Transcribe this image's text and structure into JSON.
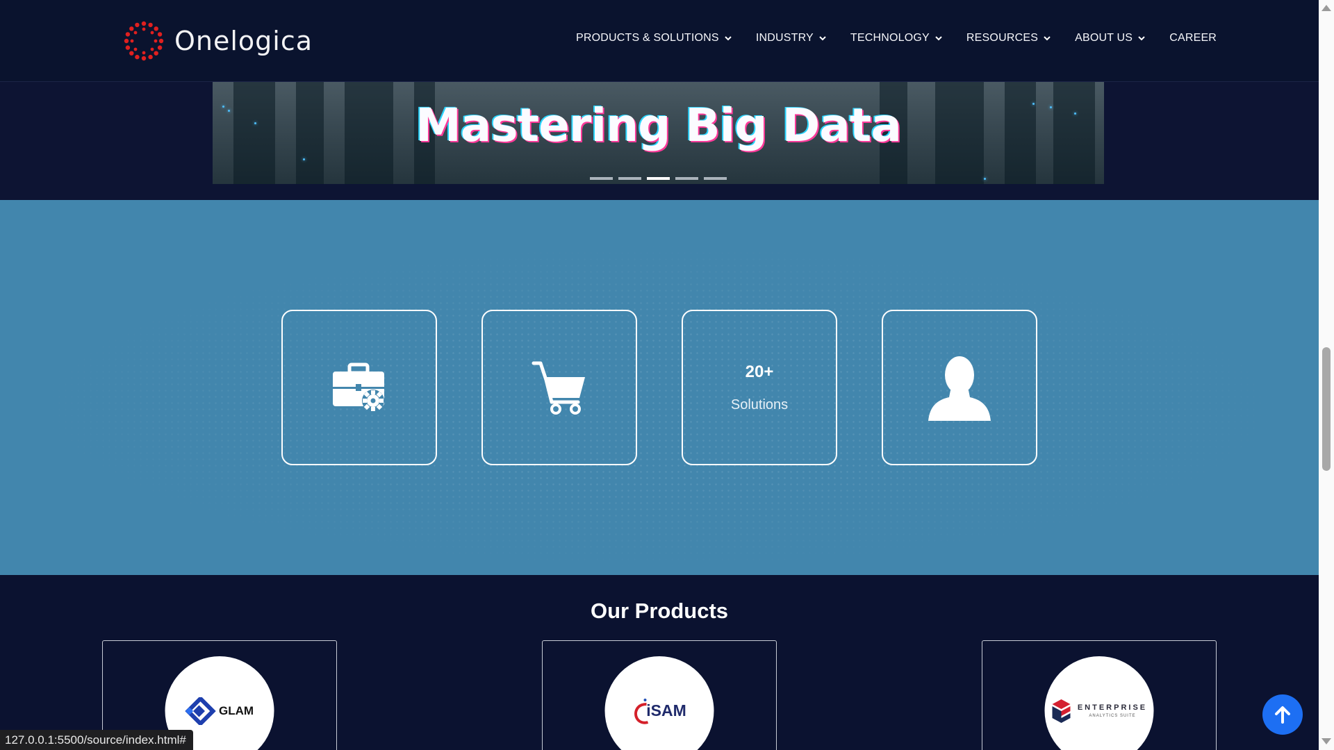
{
  "brand": {
    "name": "Onelogica",
    "mark_color": "#e02020"
  },
  "nav": {
    "items": [
      {
        "label": "PRODUCTS & SOLUTIONS",
        "has_dropdown": true
      },
      {
        "label": "INDUSTRY",
        "has_dropdown": true
      },
      {
        "label": "TECHNOLOGY",
        "has_dropdown": true
      },
      {
        "label": "RESOURCES",
        "has_dropdown": true
      },
      {
        "label": "ABOUT US",
        "has_dropdown": true
      },
      {
        "label": "CAREER",
        "has_dropdown": false
      }
    ]
  },
  "hero": {
    "title": "Mastering Big Data",
    "slide_count": 5,
    "active_slide": 3
  },
  "stats": {
    "background": "#4286ad",
    "cards": [
      {
        "icon": "briefcase-gear-icon",
        "number": "",
        "label": ""
      },
      {
        "icon": "shopping-cart-icon",
        "number": "",
        "label": ""
      },
      {
        "icon": "",
        "number": "20+",
        "label": "Solutions"
      },
      {
        "icon": "user-silhouette-icon",
        "number": "",
        "label": ""
      }
    ]
  },
  "products": {
    "title": "Our Products",
    "items": [
      {
        "logo_text": "GLAM",
        "logo_icon": "glam-logo-icon"
      },
      {
        "logo_text": "iSAM",
        "logo_icon": "isam-logo-icon"
      },
      {
        "logo_text": "ENTERPRISE",
        "logo_subtext": "ANALYTICS SUITE",
        "logo_icon": "enterprise-logo-icon"
      }
    ]
  },
  "status_bar": {
    "url": "127.0.0.1:5500/source/index.html#"
  },
  "colors": {
    "nav_bg": "#0a132e",
    "page_bg": "#0b1230",
    "accent_blue": "#1d6ff3"
  }
}
